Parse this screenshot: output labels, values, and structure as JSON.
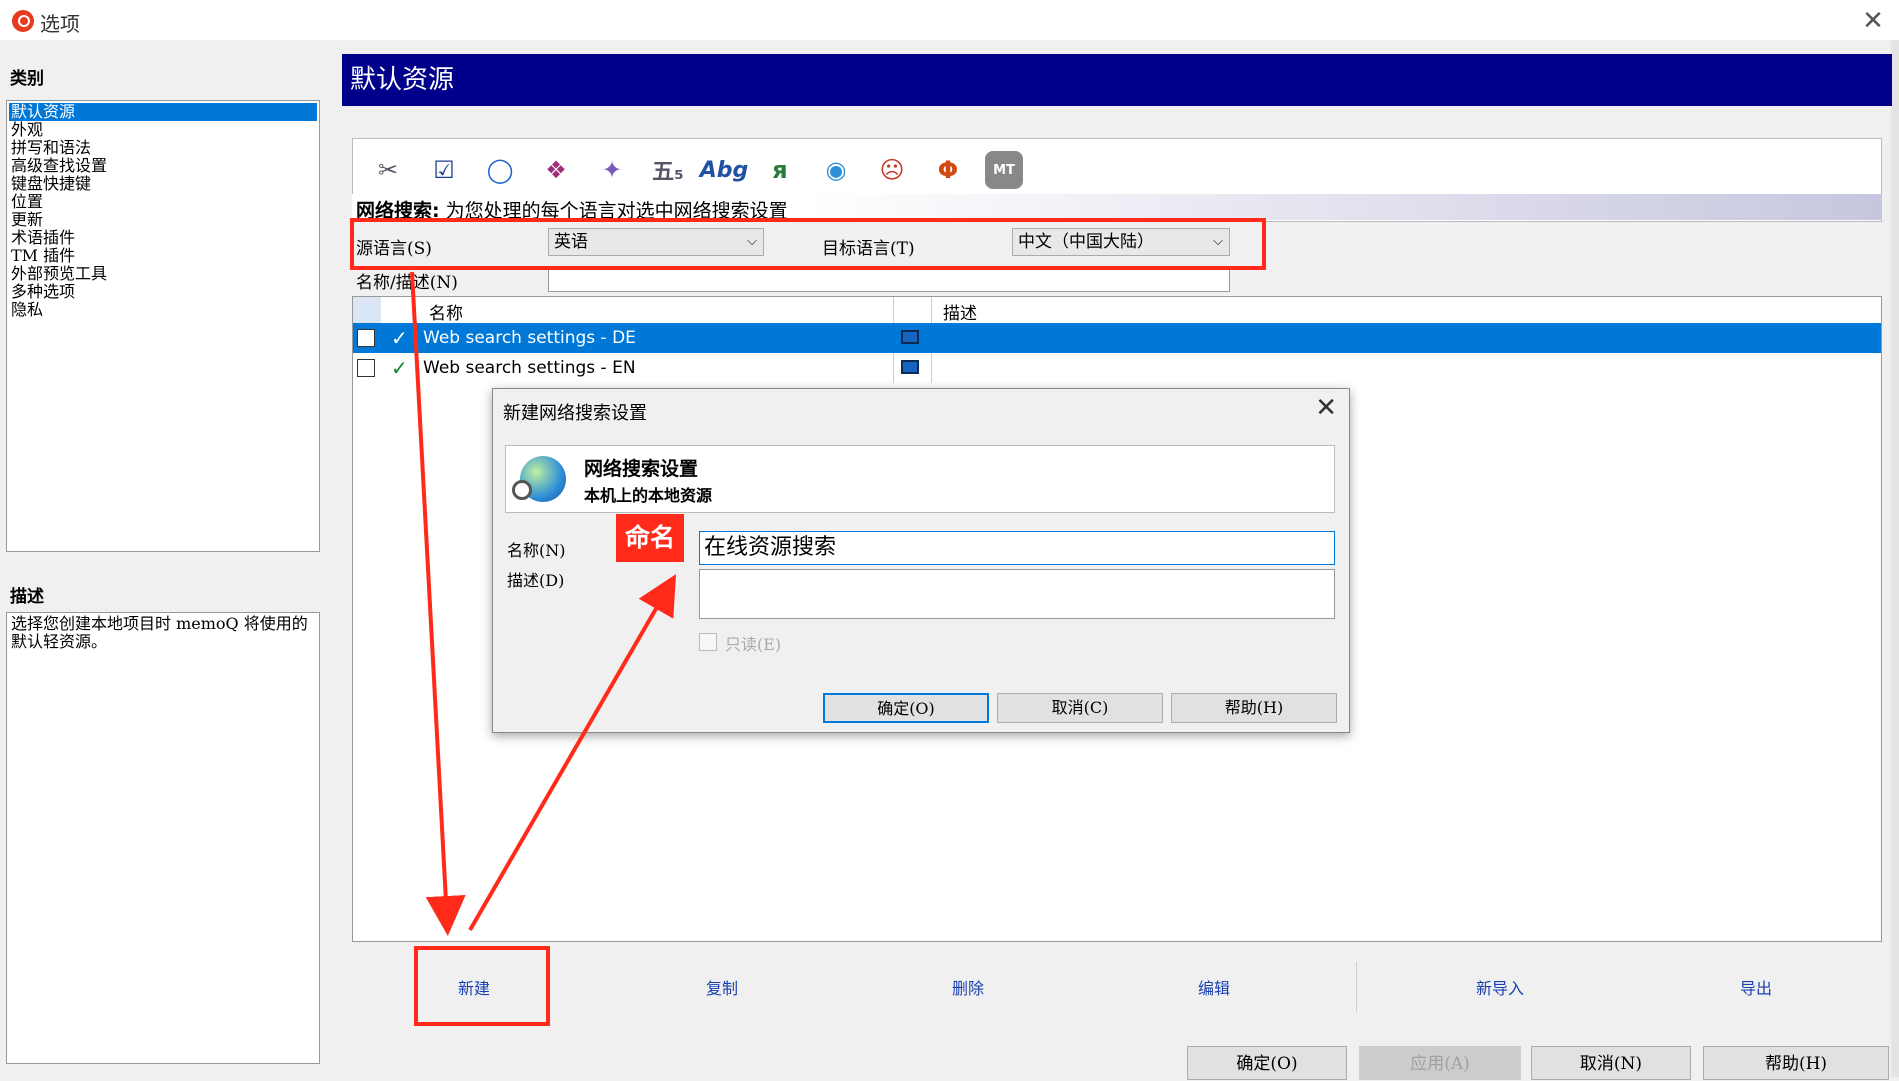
{
  "window": {
    "title": "选项",
    "close_glyph": "✕"
  },
  "categories": {
    "heading": "类别",
    "items": [
      "默认资源",
      "外观",
      "拼写和语法",
      "高级查找设置",
      "键盘快捷键",
      "位置",
      "更新",
      "术语插件",
      "TM 插件",
      "外部预览工具",
      "多种选项",
      "隐私"
    ],
    "selected_index": 0
  },
  "description": {
    "heading": "描述",
    "text": "选择您创建本地项目时 memoQ 将使用的默认轻资源。"
  },
  "header": {
    "title": "默认资源"
  },
  "toolbar": {
    "icons": [
      "translation-memory-icon",
      "termbase-icon",
      "autotranslation-icon",
      "segmentation-icon",
      "filter-config-icon",
      "auto-correct-icon",
      "spelling-icon",
      "qa-icon",
      "web-search-icon",
      "ignore-list-icon",
      "font-substitution-icon",
      "mt-icon"
    ],
    "caption_bold": "网络搜索:",
    "caption_text": " 为您处理的每个语言对选中网络搜索设置"
  },
  "filters": {
    "source_label": "源语言(S)",
    "source_value": "英语",
    "target_label": "目标语言(T)",
    "target_value": "中文（中国大陆）",
    "name_label": "名称/描述(N)",
    "name_value": ""
  },
  "grid": {
    "columns": {
      "name": "名称",
      "description": "描述"
    },
    "rows": [
      {
        "name": "Web search settings - DE",
        "description": "",
        "selected": true
      },
      {
        "name": "Web search settings - EN",
        "description": "",
        "selected": false
      }
    ]
  },
  "actions": {
    "new": "新建",
    "clone": "复制",
    "delete": "删除",
    "edit": "编辑",
    "import": "新导入",
    "export": "导出"
  },
  "bottom_buttons": {
    "ok": "确定(O)",
    "apply": "应用(A)",
    "cancel": "取消(N)",
    "help": "帮助(H)"
  },
  "dialog": {
    "title": "新建网络搜索设置",
    "banner_title": "网络搜索设置",
    "banner_subtitle": "本机上的本地资源",
    "name_label": "名称(N)",
    "name_value": "在线资源搜索",
    "desc_label": "描述(D)",
    "desc_value": "",
    "readonly_label": "只读(E)",
    "ok": "确定(O)",
    "cancel": "取消(C)",
    "help": "帮助(H)"
  },
  "annotations": {
    "callout": "命名",
    "color": "#ff2a1a"
  }
}
